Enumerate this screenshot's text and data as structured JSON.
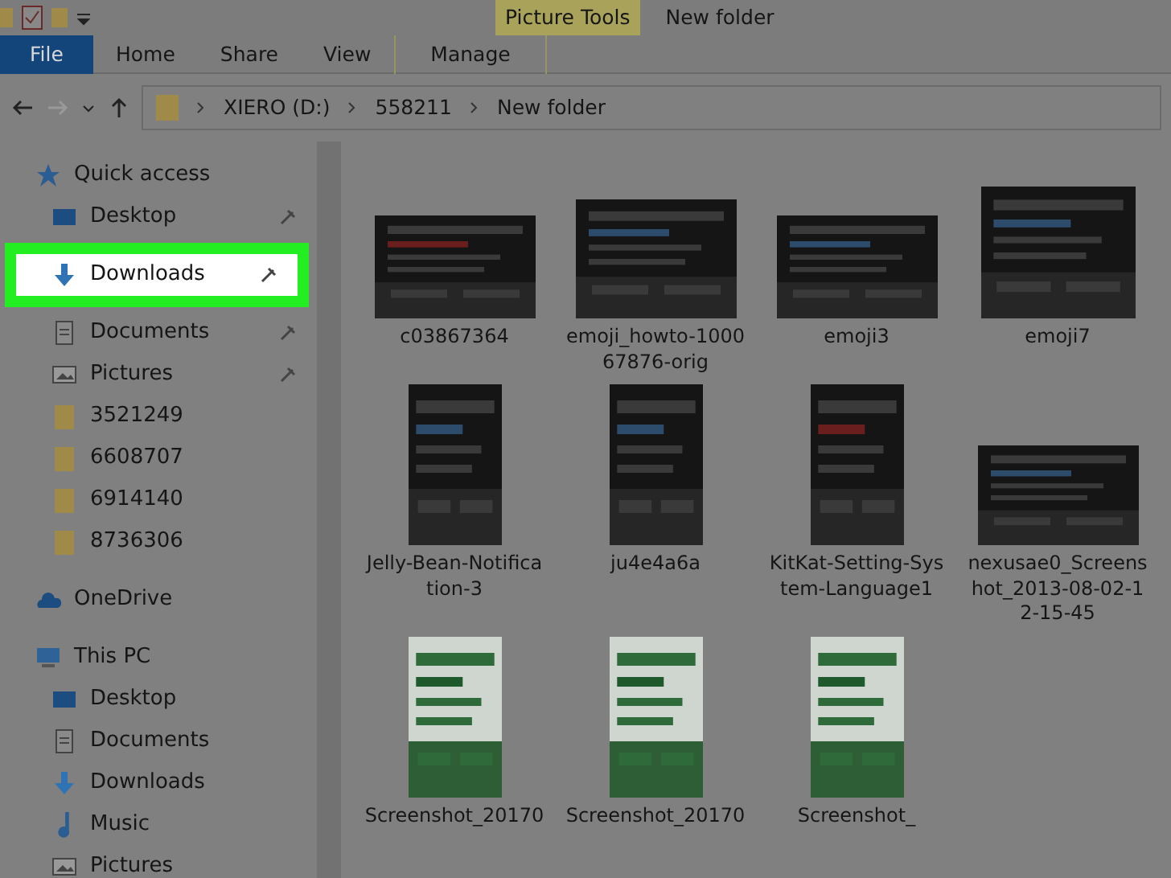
{
  "window": {
    "title": "New folder",
    "context_tab": "Picture Tools"
  },
  "ribbon_tabs": [
    {
      "label": "File",
      "kind": "file"
    },
    {
      "label": "Home",
      "kind": "tab"
    },
    {
      "label": "Share",
      "kind": "tab"
    },
    {
      "label": "View",
      "kind": "tab"
    },
    {
      "label": "Manage",
      "kind": "context"
    }
  ],
  "address": {
    "path": [
      "XIERO (D:)",
      "558211",
      "New folder"
    ]
  },
  "nav_pane": {
    "sections": [
      {
        "label": "Quick access",
        "kind": "star",
        "children": [
          {
            "label": "Desktop",
            "kind": "desktop",
            "pinned": true,
            "selected": false
          },
          {
            "label": "Downloads",
            "kind": "download",
            "pinned": true,
            "selected": true
          },
          {
            "label": "Documents",
            "kind": "documents",
            "pinned": true,
            "selected": false
          },
          {
            "label": "Pictures",
            "kind": "pictures",
            "pinned": true,
            "selected": false
          },
          {
            "label": "3521249",
            "kind": "folder",
            "pinned": false,
            "selected": false
          },
          {
            "label": "6608707",
            "kind": "folder",
            "pinned": false,
            "selected": false
          },
          {
            "label": "6914140",
            "kind": "folder",
            "pinned": false,
            "selected": false
          },
          {
            "label": "8736306",
            "kind": "folder",
            "pinned": false,
            "selected": false
          }
        ]
      },
      {
        "label": "OneDrive",
        "kind": "cloud"
      },
      {
        "label": "This PC",
        "kind": "pc",
        "children": [
          {
            "label": "Desktop",
            "kind": "desktop",
            "pinned": false,
            "selected": false
          },
          {
            "label": "Documents",
            "kind": "documents",
            "pinned": false,
            "selected": false
          },
          {
            "label": "Downloads",
            "kind": "download",
            "pinned": false,
            "selected": false
          },
          {
            "label": "Music",
            "kind": "music",
            "pinned": false,
            "selected": false
          },
          {
            "label": "Pictures",
            "kind": "pictures",
            "pinned": false,
            "selected": false
          }
        ]
      }
    ]
  },
  "files": [
    {
      "name": "c03867364",
      "kind": "picture"
    },
    {
      "name": "emoji_howto-100067876-orig",
      "kind": "picture"
    },
    {
      "name": "emoji3",
      "kind": "picture"
    },
    {
      "name": "emoji7",
      "kind": "picture"
    },
    {
      "name": "Jelly-Bean-Notification-3",
      "kind": "picture"
    },
    {
      "name": "ju4e4a6a",
      "kind": "picture"
    },
    {
      "name": "KitKat-Setting-System-Language1",
      "kind": "picture"
    },
    {
      "name": "nexusae0_Screenshot_2013-08-02-12-15-45",
      "kind": "picture"
    },
    {
      "name": "Screenshot_20170",
      "kind": "picture"
    },
    {
      "name": "Screenshot_20170",
      "kind": "picture"
    },
    {
      "name": "Screenshot_",
      "kind": "picture"
    }
  ]
}
